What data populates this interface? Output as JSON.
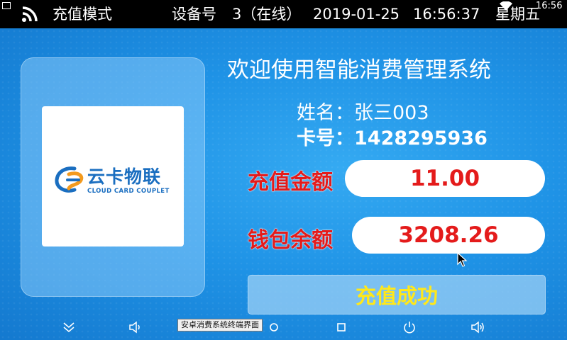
{
  "status_bar": {
    "mode": "充值模式",
    "device_label": "设备号",
    "device_no": "3（在线）",
    "date": "2019-01-25",
    "time": "16:56:37",
    "weekday": "星期五",
    "system_clock": "16:56"
  },
  "welcome_title": "欢迎使用智能消费管理系统",
  "logo": {
    "cn": "云卡物联",
    "en": "CLOUD CARD COUPLET"
  },
  "user": {
    "name_line": "姓名：张三003",
    "card_line": "卡号：1428295936"
  },
  "recharge": {
    "label": "充值金额",
    "value": "11.00"
  },
  "balance": {
    "label": "钱包余额",
    "value": "3208.26"
  },
  "result": "充值成功",
  "tooltip": "安卓消费系统终端界面",
  "nav_icons": [
    "chevron-down-icon",
    "volume-down-icon",
    "home-icon",
    "recents-icon",
    "power-icon",
    "volume-up-icon"
  ],
  "colors": {
    "accent_red": "#e41b1b",
    "success_yellow": "#ffe81a",
    "background_blue": "#1e8ee0"
  }
}
